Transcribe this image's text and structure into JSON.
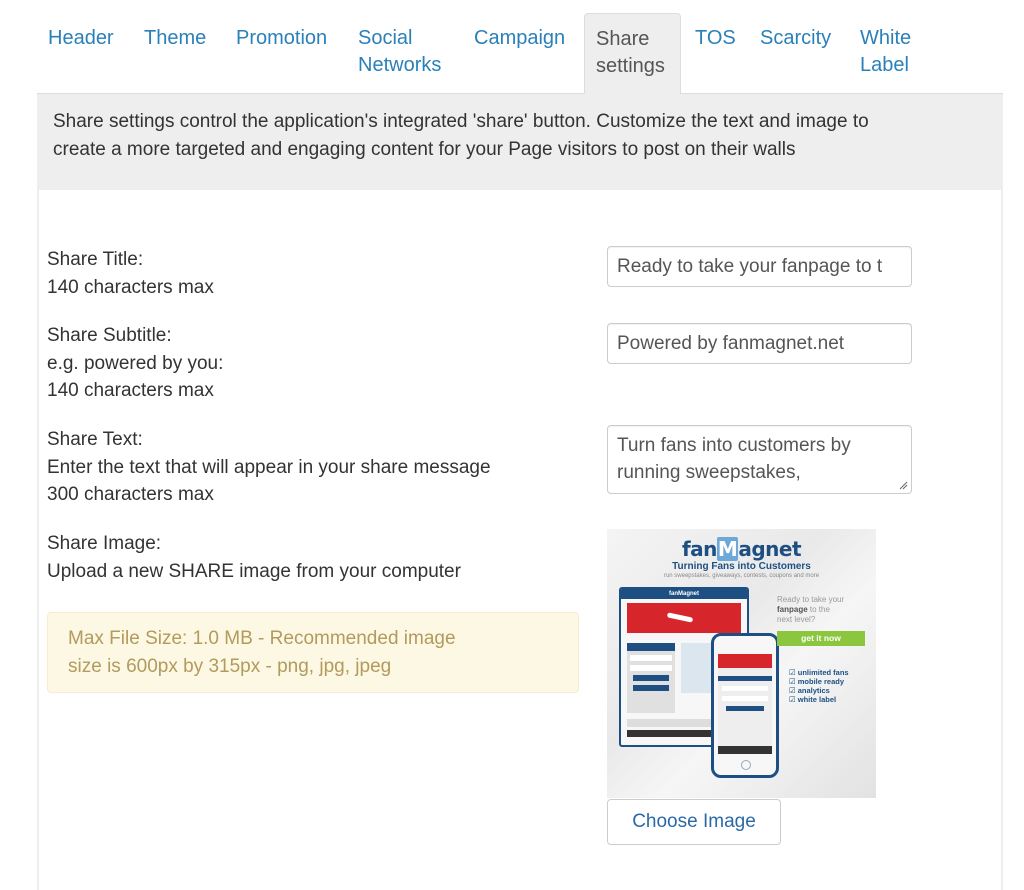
{
  "tabs": [
    {
      "label": "Header",
      "active": false
    },
    {
      "label": "Theme",
      "active": false
    },
    {
      "label": "Promotion",
      "active": false
    },
    {
      "label": "Social\nNetworks",
      "line1": "Social",
      "line2": "Networks",
      "active": false
    },
    {
      "label": "Campaign",
      "active": false
    },
    {
      "label": "Share\nsettings",
      "line1": "Share",
      "line2": "settings",
      "active": true
    },
    {
      "label": "TOS",
      "active": false
    },
    {
      "label": "Scarcity",
      "active": false
    },
    {
      "label": "White\nLabel",
      "line1": "White",
      "line2": "Label",
      "active": false
    }
  ],
  "description": {
    "line1": "Share settings control the application's integrated 'share' button. Customize the text and image to",
    "line2": "create a more targeted and engaging content for your Page visitors to post on their walls"
  },
  "fields": {
    "share_title": {
      "label": "Share Title:",
      "hint": "140 characters max",
      "value": "Ready to take your fanpage to t"
    },
    "share_subtitle": {
      "label": "Share Subtitle:",
      "hint1": "e.g. powered by you:",
      "hint2": "140 characters max",
      "value": "Powered by fanmagnet.net"
    },
    "share_text": {
      "label": "Share Text:",
      "hint1": "Enter the text that will appear in your share message",
      "hint2": "300 characters max",
      "value": "Turn fans into customers by running sweepstakes,"
    },
    "share_image": {
      "label": "Share Image:",
      "hint": "Upload a new SHARE image from your computer",
      "choose_button": "Choose Image"
    }
  },
  "alert": {
    "line1": "Max File Size: 1.0 MB - Recommended image",
    "line2": "size is 600px by 315px - png, jpg, jpeg"
  },
  "share_image_preview": {
    "logo_prefix": "fan",
    "logo_m": "M",
    "logo_suffix": "agnet",
    "tagline": "Turning Fans into Customers",
    "subline": "run sweepstakes, giveaways, contests, coupons and more",
    "browser_title": "fanMagnet",
    "cta_line1": "Ready to take your",
    "cta_bold": "fanpage",
    "cta_line2": " to the",
    "cta_line3": "next level?",
    "cta_button": "get it now",
    "features": [
      "unlimited fans",
      "mobile ready",
      "analytics",
      "white label"
    ]
  },
  "colors": {
    "link": "#2a80b9",
    "active_tab_bg": "#eeeeee",
    "alert_bg": "#fcf8e3",
    "alert_text": "#b39a5d",
    "brand_blue": "#1d4f82",
    "brand_red": "#d6262b",
    "brand_green": "#8cc63f"
  }
}
